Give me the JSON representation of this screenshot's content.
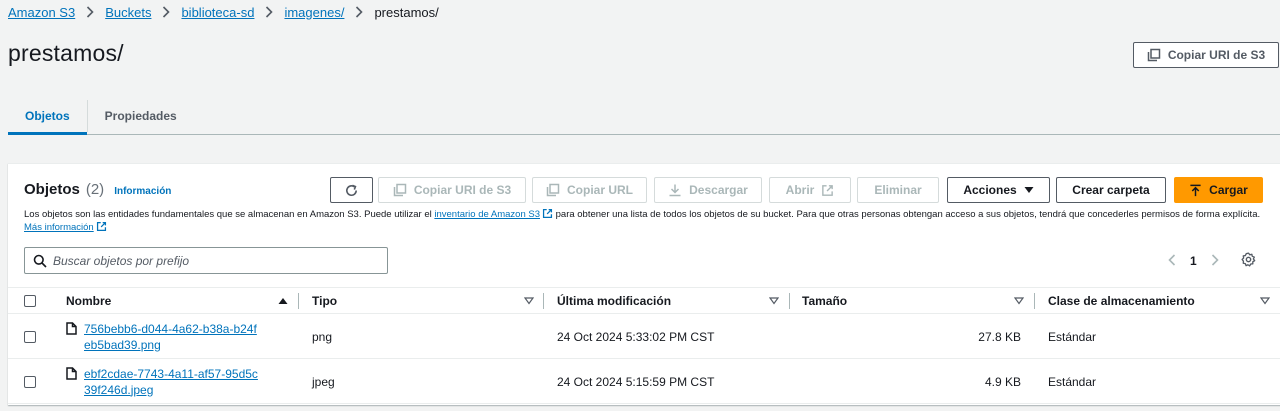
{
  "breadcrumb": [
    "Amazon S3",
    "Buckets",
    "biblioteca-sd",
    "imagenes/"
  ],
  "breadcrumb_current": "prestamos/",
  "page_title": "prestamos/",
  "top_copy_uri": "Copiar URI de S3",
  "tabs": [
    {
      "label": "Objetos",
      "active": true
    },
    {
      "label": "Propiedades",
      "active": false
    }
  ],
  "panel": {
    "title": "Objetos",
    "count": "(2)",
    "info_link": "Información",
    "description_1": "Los objetos son las entidades fundamentales que se almacenan en Amazon S3. Puede utilizar el ",
    "description_link": "inventario de Amazon S3",
    "description_2": " para obtener una lista de todos los objetos de su bucket. Para que otras personas obtengan acceso a sus objetos, tendrá que concederles permisos de forma explícita. ",
    "more_info_link": "Más información"
  },
  "toolbar": {
    "refresh_icon": "refresh-icon",
    "copy_uri": "Copiar URI de S3",
    "copy_url": "Copiar URL",
    "download": "Descargar",
    "open": "Abrir",
    "delete": "Eliminar",
    "actions": "Acciones",
    "create_folder": "Crear carpeta",
    "upload": "Cargar"
  },
  "search": {
    "placeholder": "Buscar objetos por prefijo",
    "value": ""
  },
  "pagination": {
    "current_page": "1"
  },
  "table": {
    "columns": [
      "Nombre",
      "Tipo",
      "Última modificación",
      "Tamaño",
      "Clase de almacenamiento"
    ],
    "rows": [
      {
        "name": "756bebb6-d044-4a62-b38a-b24feb5bad39.png",
        "type": "png",
        "modified": "24 Oct 2024 5:33:02 PM CST",
        "size": "27.8 KB",
        "storage_class": "Estándar"
      },
      {
        "name": "ebf2cdae-7743-4a11-af57-95d5c39f246d.jpeg",
        "type": "jpeg",
        "modified": "24 Oct 2024 5:15:59 PM CST",
        "size": "4.9 KB",
        "storage_class": "Estándar"
      }
    ]
  },
  "colors": {
    "link": "#0073bb",
    "primary": "#ff9900",
    "text": "#16191f",
    "disabled": "#aab7b8"
  }
}
